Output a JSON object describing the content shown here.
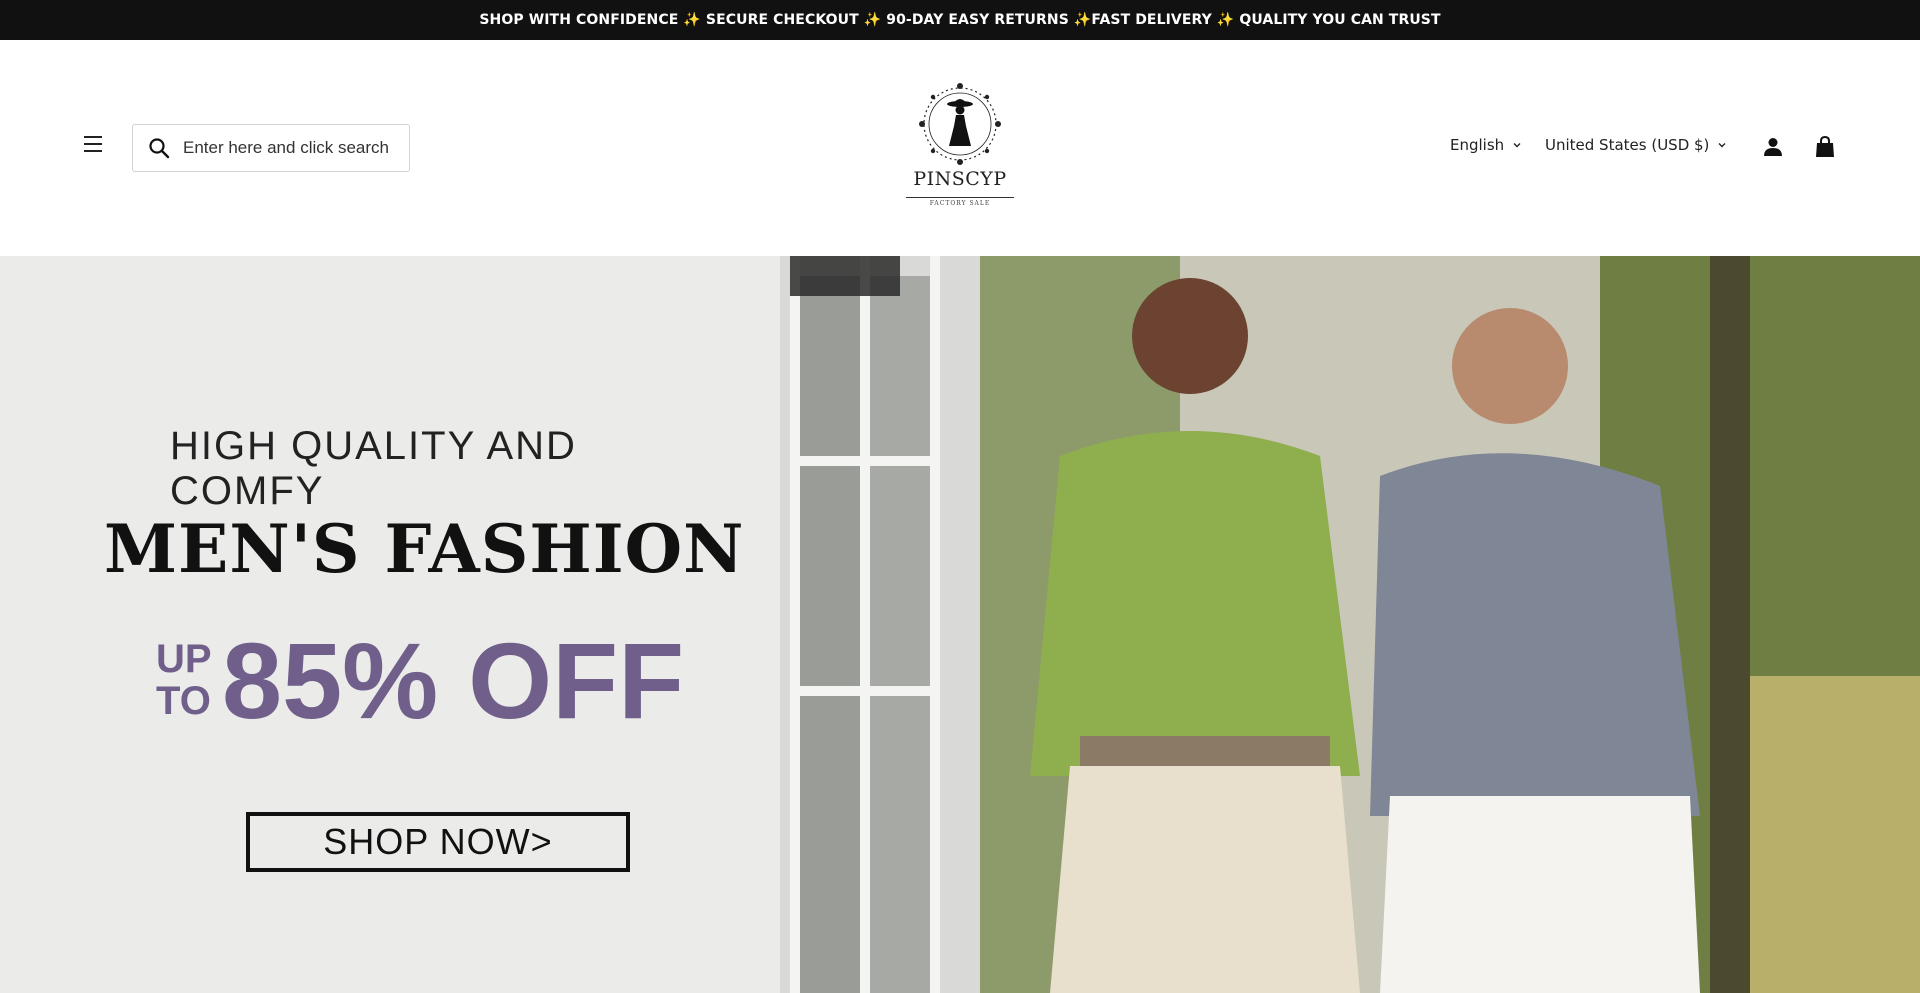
{
  "announcement": {
    "text": "SHOP WITH CONFIDENCE ✨ SECURE CHECKOUT ✨ 90-DAY EASY RETURNS ✨FAST DELIVERY ✨ QUALITY YOU CAN TRUST"
  },
  "header": {
    "search_placeholder": "Enter here and click search",
    "logo": {
      "name": "PINSCYP",
      "subtitle": "FACTORY SALE"
    },
    "language": "English",
    "currency": "United States (USD $)"
  },
  "hero": {
    "tagline": "HIGH QUALITY AND COMFY",
    "title": "MEN'S FASHION",
    "up_to_line1": "UP",
    "up_to_line2": "TO",
    "discount": "85% OFF",
    "cta_label": "SHOP NOW>"
  },
  "colors": {
    "announcement_bg": "#111111",
    "discount_purple": "#6f5f8a"
  }
}
